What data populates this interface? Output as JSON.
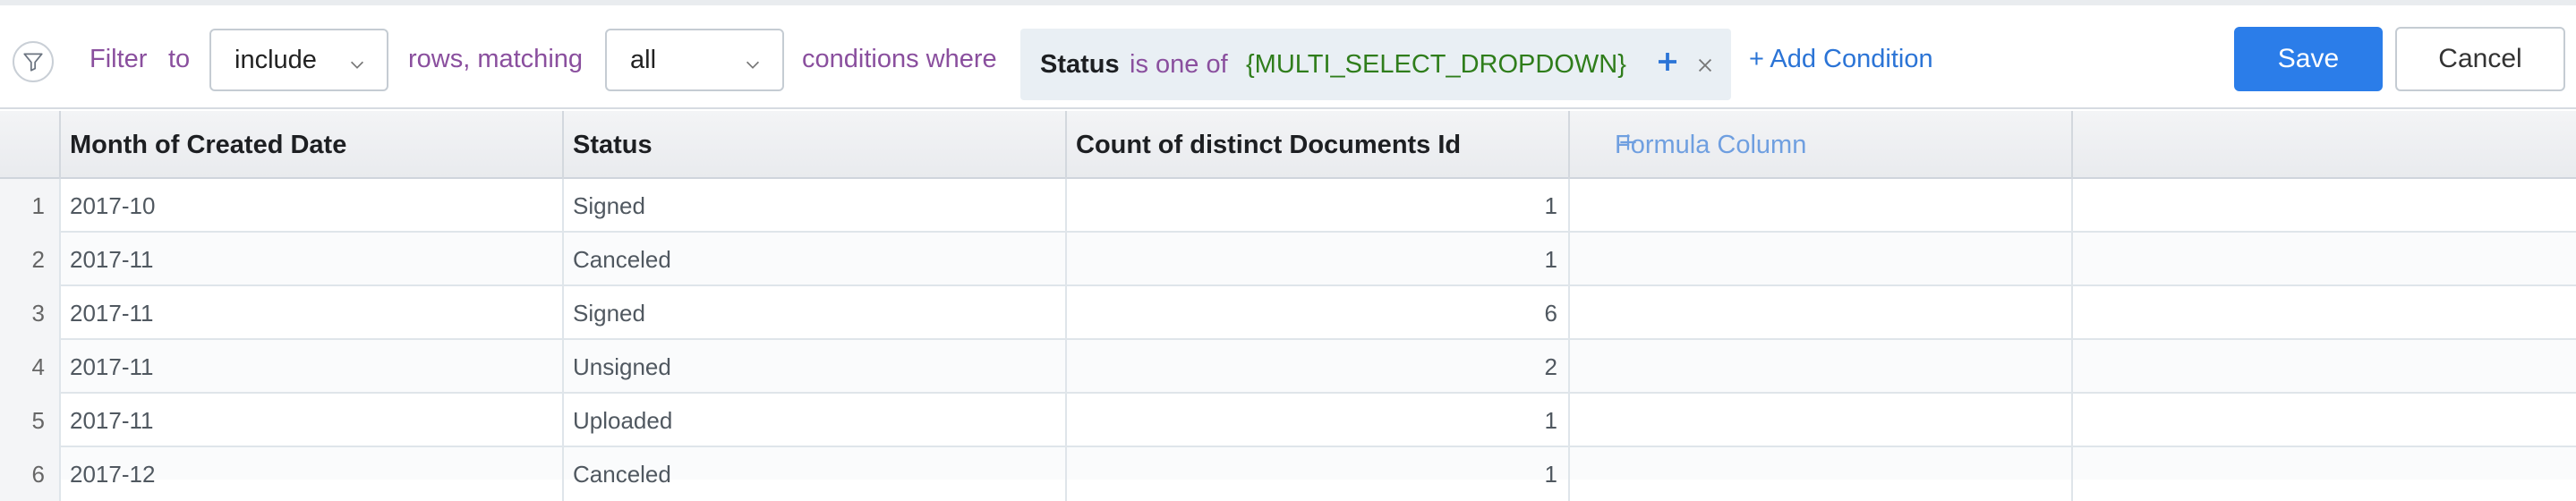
{
  "filter_bar": {
    "filter_label": "Filter",
    "to_label": "to",
    "include_select": {
      "value": "include"
    },
    "rows_matching_label": "rows, matching",
    "match_select": {
      "value": "all"
    },
    "conditions_where_label": "conditions where",
    "condition": {
      "field": "Status",
      "operator": "is one of",
      "value": "{MULTI_SELECT_DROPDOWN}"
    },
    "add_condition_label": "+ Add Condition",
    "save_label": "Save",
    "cancel_label": "Cancel"
  },
  "table": {
    "columns": [
      "Month of Created Date",
      "Status",
      "Count of distinct Documents Id"
    ],
    "formula_column_label": "Formula Column",
    "rows": [
      {
        "index": "1",
        "month": "2017-10",
        "status": "Signed",
        "count": "1"
      },
      {
        "index": "2",
        "month": "2017-11",
        "status": "Canceled",
        "count": "1"
      },
      {
        "index": "3",
        "month": "2017-11",
        "status": "Signed",
        "count": "6"
      },
      {
        "index": "4",
        "month": "2017-11",
        "status": "Unsigned",
        "count": "2"
      },
      {
        "index": "5",
        "month": "2017-11",
        "status": "Uploaded",
        "count": "1"
      },
      {
        "index": "6",
        "month": "2017-12",
        "status": "Canceled",
        "count": "1"
      }
    ]
  },
  "colors": {
    "accent_blue": "#2b7de9",
    "label_purple": "#8a4f9e",
    "value_green": "#2f7d1b"
  },
  "icons": [
    "filter-icon",
    "chevron-down-icon",
    "plus-icon",
    "close-icon"
  ]
}
